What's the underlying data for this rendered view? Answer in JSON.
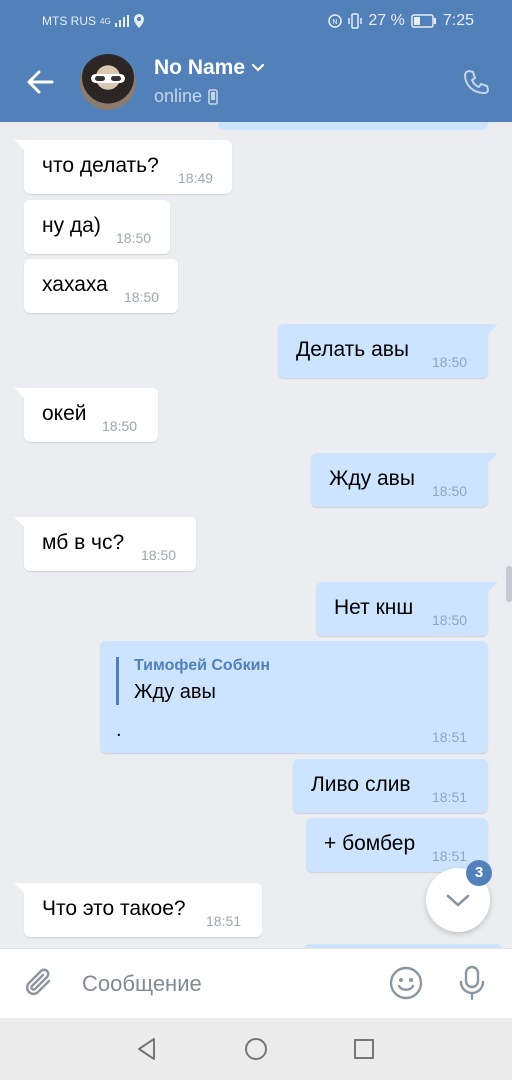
{
  "status_bar": {
    "carrier": "MTS RUS",
    "network": "4G",
    "battery": "27 %",
    "time": "7:25"
  },
  "header": {
    "name": "No Name",
    "status": "online"
  },
  "messages": [
    {
      "dir": "in",
      "text": "что делать?",
      "time": "18:49"
    },
    {
      "dir": "in",
      "text": "ну да)",
      "time": "18:50"
    },
    {
      "dir": "in",
      "text": "хахаха",
      "time": "18:50"
    },
    {
      "dir": "out",
      "text": "Делать авы",
      "time": "18:50"
    },
    {
      "dir": "in",
      "text": "окей",
      "time": "18:50"
    },
    {
      "dir": "out",
      "text": "Жду авы",
      "time": "18:50"
    },
    {
      "dir": "in",
      "text": "мб в чс?",
      "time": "18:50"
    },
    {
      "dir": "out",
      "text": "Нет кнш",
      "time": "18:50"
    },
    {
      "dir": "out",
      "reply_author": "Тимофей Собкин",
      "reply_text": "Жду авы",
      "text": ".",
      "time": "18:51"
    },
    {
      "dir": "out",
      "text": "Ливо слив",
      "time": "18:51"
    },
    {
      "dir": "out",
      "text": "+ бомбер",
      "time": "18:51"
    },
    {
      "dir": "in",
      "text": "Что это такое?",
      "time": "18:51"
    }
  ],
  "scroll_down": {
    "unread_count": "3"
  },
  "composer": {
    "placeholder": "Сообщение"
  },
  "colors": {
    "header": "#5181b8",
    "incoming": "#ffffff",
    "outgoing": "#cce4ff",
    "background": "#ebedf0"
  }
}
